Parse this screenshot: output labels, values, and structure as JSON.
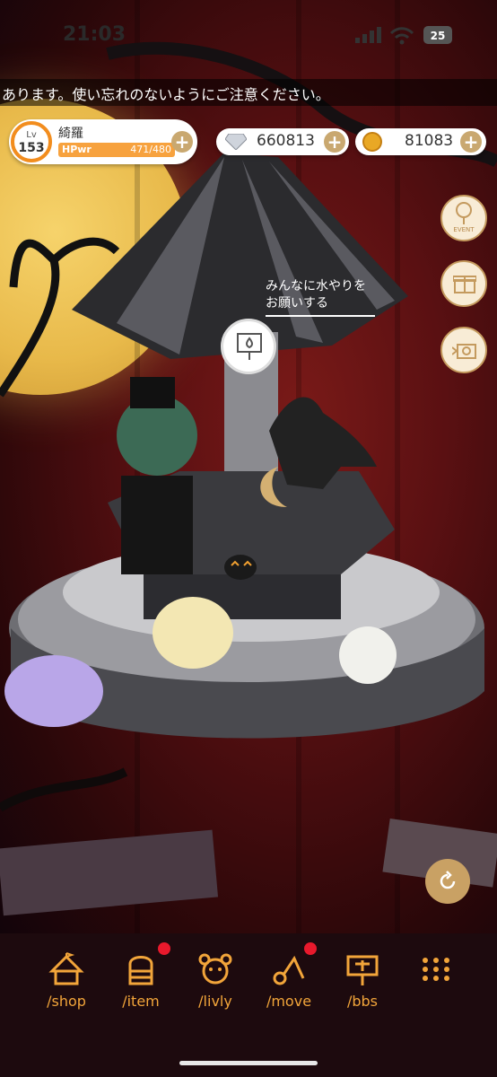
{
  "status_bar": {
    "time": "21:03",
    "battery": "25"
  },
  "ticker": {
    "text": "あります。使い忘れのないようにご注意ください。"
  },
  "profile": {
    "level_label": "Lv",
    "level": "153",
    "name": "綺羅",
    "hp_label": "HPwr",
    "hp_value": "471/480"
  },
  "currencies": {
    "gems": "660813",
    "coins": "81083"
  },
  "side_buttons": {
    "event_label": "EVENT"
  },
  "speech": {
    "line1": "みんなに水やりを",
    "line2": "お願いする"
  },
  "nav": [
    {
      "label": "/shop",
      "icon": "tent-icon",
      "badge": false
    },
    {
      "label": "/item",
      "icon": "dresser-icon",
      "badge": true
    },
    {
      "label": "/livly",
      "icon": "livly-face-icon",
      "badge": false
    },
    {
      "label": "/move",
      "icon": "move-icon",
      "badge": true
    },
    {
      "label": "/bbs",
      "icon": "signboard-icon",
      "badge": false
    }
  ],
  "colors": {
    "accent": "#f2a53a",
    "badge": "#e8192c",
    "gold": "#c9a870"
  }
}
